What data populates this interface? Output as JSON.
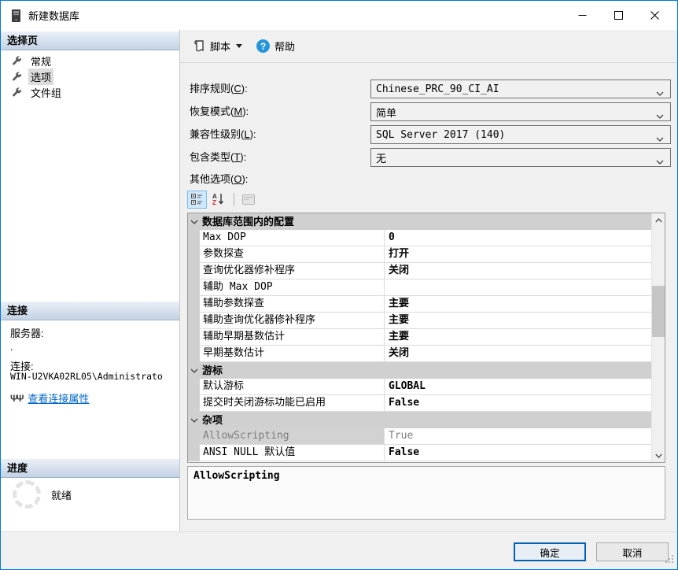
{
  "colors": {
    "accent": "#0078d7",
    "link": "#0066cc",
    "help_icon": "#2596d9",
    "category_bg": "#d0d0d0"
  },
  "window": {
    "title": "新建数据库"
  },
  "sidebar": {
    "select_header": "选择页",
    "pages": [
      {
        "label": "常规",
        "selected": false
      },
      {
        "label": "选项",
        "selected": true
      },
      {
        "label": "文件组",
        "selected": false
      }
    ],
    "connection_header": "连接",
    "server_label": "服务器:",
    "server_value": ".",
    "connection_label": "连接:",
    "connection_value": "WIN-U2VKA02RL05\\Administrato",
    "view_connection_link": "查看连接属性",
    "progress_header": "进度",
    "progress_status": "就绪"
  },
  "toolbar": {
    "script_label": "脚本",
    "help_label": "帮助",
    "help_glyph": "?"
  },
  "form": {
    "fields": [
      {
        "pre": "排序规则(",
        "key": "C",
        "post": "):",
        "value": "Chinese_PRC_90_CI_AI"
      },
      {
        "pre": "恢复模式(",
        "key": "M",
        "post": "):",
        "value": "简单"
      },
      {
        "pre": "兼容性级别(",
        "key": "L",
        "post": "):",
        "value": "SQL Server 2017 (140)"
      },
      {
        "pre": "包含类型(",
        "key": "T",
        "post": "):",
        "value": "无"
      }
    ],
    "other_options": {
      "pre": "其他选项(",
      "key": "O",
      "post": "):"
    }
  },
  "grid": {
    "rows": [
      {
        "type": "category",
        "name": "数据库范围内的配置"
      },
      {
        "type": "prop",
        "name": "Max DOP",
        "value": "0",
        "style": "bold"
      },
      {
        "type": "prop",
        "name": "参数探查",
        "value": "打开",
        "style": "bold"
      },
      {
        "type": "prop",
        "name": "查询优化器修补程序",
        "value": "关闭",
        "style": "bold"
      },
      {
        "type": "prop",
        "name": "辅助 Max DOP",
        "value": "",
        "style": "normal"
      },
      {
        "type": "prop",
        "name": "辅助参数探查",
        "value": "主要",
        "style": "bold"
      },
      {
        "type": "prop",
        "name": "辅助查询优化器修补程序",
        "value": "主要",
        "style": "bold"
      },
      {
        "type": "prop",
        "name": "辅助早期基数估计",
        "value": "主要",
        "style": "bold"
      },
      {
        "type": "prop",
        "name": "早期基数估计",
        "value": "关闭",
        "style": "bold"
      },
      {
        "type": "category",
        "name": "游标"
      },
      {
        "type": "prop",
        "name": "默认游标",
        "value": "GLOBAL",
        "style": "bold"
      },
      {
        "type": "prop",
        "name": "提交时关闭游标功能已启用",
        "value": "False",
        "style": "bold"
      },
      {
        "type": "category",
        "name": "杂项"
      },
      {
        "type": "prop",
        "name": "AllowScripting",
        "value": "True",
        "style": "readonly"
      },
      {
        "type": "prop",
        "name": "ANSI NULL 默认值",
        "value": "False",
        "style": "bold"
      }
    ],
    "description": "AllowScripting"
  },
  "buttons": {
    "ok": "确定",
    "cancel": "取消"
  }
}
